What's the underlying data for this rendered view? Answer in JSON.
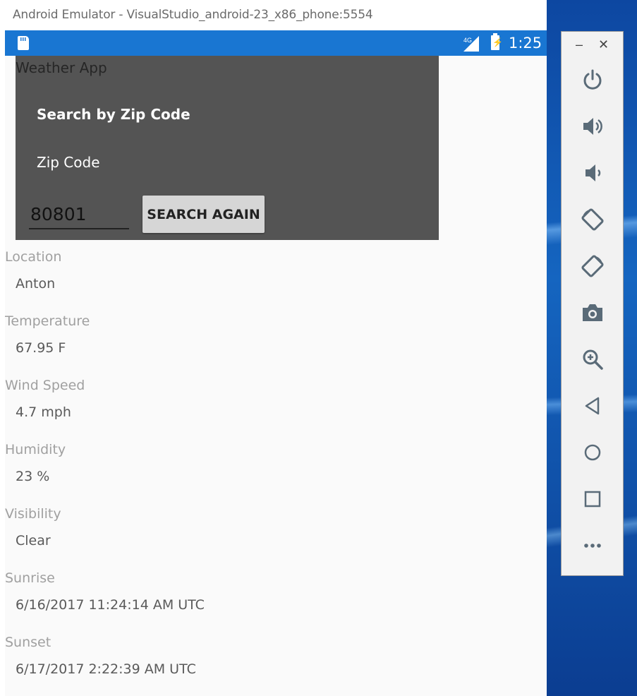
{
  "window": {
    "title": "Android Emulator - VisualStudio_android-23_x86_phone:5554"
  },
  "statusbar": {
    "network": "4G",
    "time": "1:25"
  },
  "app": {
    "title": "Weather App"
  },
  "dialog": {
    "heading": "Search by Zip Code",
    "zip_label": "Zip Code",
    "zip_value": "80801",
    "search_button": "SEARCH AGAIN"
  },
  "fields": [
    {
      "label": "Location",
      "value": "Anton"
    },
    {
      "label": "Temperature",
      "value": "67.95 F"
    },
    {
      "label": "Wind Speed",
      "value": "4.7 mph"
    },
    {
      "label": "Humidity",
      "value": "23 %"
    },
    {
      "label": "Visibility",
      "value": "Clear"
    },
    {
      "label": "Sunrise",
      "value": "6/16/2017 11:24:14 AM UTC"
    },
    {
      "label": "Sunset",
      "value": "6/17/2017 2:22:39 AM UTC"
    }
  ],
  "toolbar": {
    "minimize": "–",
    "close": "✕",
    "buttons": [
      "power-icon",
      "volume-up-icon",
      "volume-down-icon",
      "rotate-left-icon",
      "rotate-right-icon",
      "camera-icon",
      "zoom-icon",
      "back-icon",
      "home-icon",
      "overview-icon",
      "more-icon"
    ]
  },
  "colors": {
    "statusbar": "#1976d2",
    "dialog": "#545454",
    "screen": "#fafafa"
  }
}
